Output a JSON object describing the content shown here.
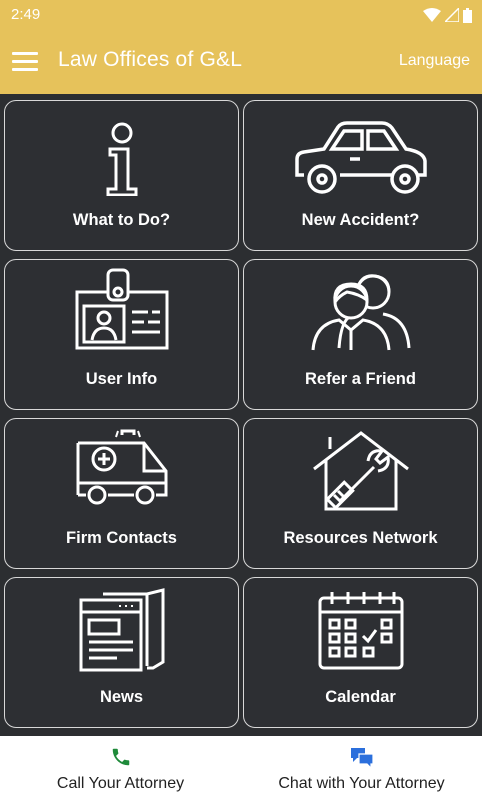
{
  "status": {
    "time": "2:49"
  },
  "appbar": {
    "title": "Law Offices of G&L",
    "language": "Language"
  },
  "tiles": [
    {
      "label": "What to Do?",
      "icon": "info-icon"
    },
    {
      "label": "New Accident?",
      "icon": "car-icon"
    },
    {
      "label": "User Info",
      "icon": "id-badge-icon"
    },
    {
      "label": "Refer a Friend",
      "icon": "people-icon"
    },
    {
      "label": "Firm Contacts",
      "icon": "ambulance-icon"
    },
    {
      "label": "Resources Network",
      "icon": "house-tools-icon"
    },
    {
      "label": "News",
      "icon": "newspaper-icon"
    },
    {
      "label": "Calendar",
      "icon": "calendar-icon"
    }
  ],
  "bottom": {
    "call_label": "Call Your Attorney",
    "chat_label": "Chat with Your Attorney"
  },
  "colors": {
    "accent": "#e6c25b",
    "tile_bg": "#2d2f33",
    "call_icon": "#1f8a3a",
    "chat_icon": "#2b6fdc"
  }
}
